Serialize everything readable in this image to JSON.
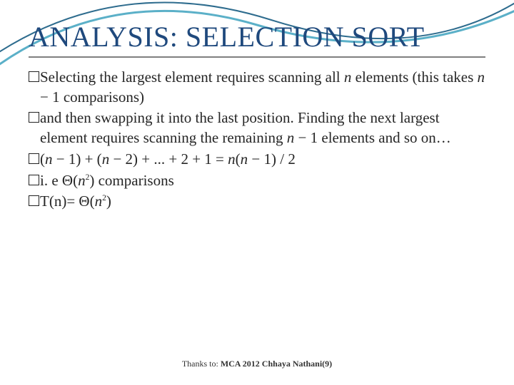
{
  "slide": {
    "title": "ANALYSIS: SELECTION SORT",
    "bullets": [
      {
        "parts": [
          {
            "t": "Selecting the largest element requires scanning all "
          },
          {
            "t": "n",
            "i": true
          },
          {
            "t": " elements (this takes "
          },
          {
            "t": "n",
            "i": true
          },
          {
            "t": " − 1 comparisons)"
          }
        ]
      },
      {
        "parts": [
          {
            "t": "and then swapping it into the last position. Finding the next largest element requires scanning the remaining "
          },
          {
            "t": "n",
            "i": true
          },
          {
            "t": " − 1 elements and so on…"
          }
        ]
      },
      {
        "parts": [
          {
            "t": " ("
          },
          {
            "t": "n",
            "i": true
          },
          {
            "t": " − 1) + ("
          },
          {
            "t": "n",
            "i": true
          },
          {
            "t": " − 2) + ... + 2 + 1 = "
          },
          {
            "t": "n",
            "i": true
          },
          {
            "t": "("
          },
          {
            "t": "n",
            "i": true
          },
          {
            "t": " − 1) / 2"
          }
        ]
      },
      {
        "parts": [
          {
            "t": " i. e Θ("
          },
          {
            "t": "n",
            "i": true
          },
          {
            "t": "2",
            "sup": true
          },
          {
            "t": ") comparisons"
          }
        ]
      },
      {
        "parts": [
          {
            "t": "T(n)= Θ("
          },
          {
            "t": "n",
            "i": true
          },
          {
            "t": "2",
            "sup": true
          },
          {
            "t": ")"
          }
        ]
      }
    ],
    "footer_prefix": "Thanks to: ",
    "footer_bold": "MCA 2012  Chhaya Nathani(9)"
  },
  "decor": {
    "stroke1": "#5BB0C8",
    "stroke2": "#2E6C8E"
  }
}
